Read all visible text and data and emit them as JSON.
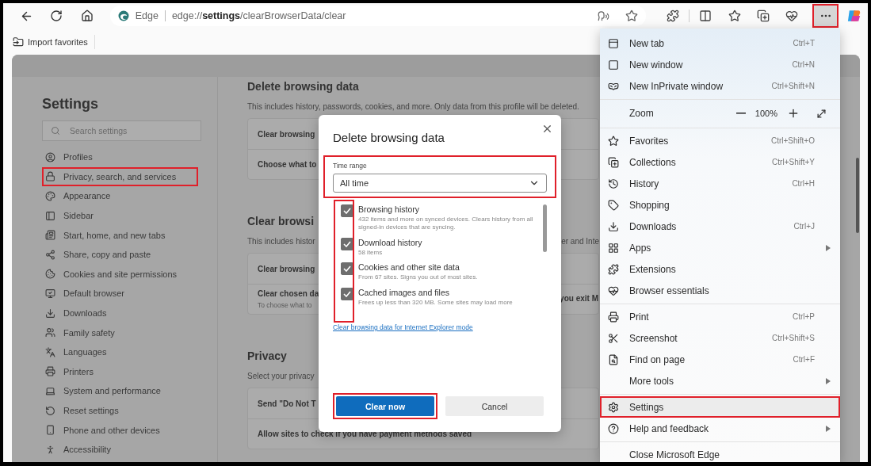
{
  "toolbar": {
    "site_label": "Edge",
    "url": "edge://**settings**/clearBrowserData/clear",
    "more_button": {
      "highlighted": true
    }
  },
  "favorites_bar": {
    "items": [
      {
        "label": "Import favorites"
      }
    ]
  },
  "sidebar": {
    "title": "Settings",
    "search": {
      "placeholder": "Search settings"
    },
    "items": [
      {
        "label": "Profiles",
        "highlighted": false
      },
      {
        "label": "Privacy, search, and services",
        "highlighted": true
      },
      {
        "label": "Appearance",
        "highlighted": false
      },
      {
        "label": "Sidebar",
        "highlighted": false
      },
      {
        "label": "Start, home, and new tabs",
        "highlighted": false
      },
      {
        "label": "Share, copy and paste",
        "highlighted": false
      },
      {
        "label": "Cookies and site permissions",
        "highlighted": false
      },
      {
        "label": "Default browser",
        "highlighted": false
      },
      {
        "label": "Downloads",
        "highlighted": false
      },
      {
        "label": "Family safety",
        "highlighted": false
      },
      {
        "label": "Languages",
        "highlighted": false
      },
      {
        "label": "Printers",
        "highlighted": false
      },
      {
        "label": "System and performance",
        "highlighted": false
      },
      {
        "label": "Reset settings",
        "highlighted": false
      },
      {
        "label": "Phone and other devices",
        "highlighted": false
      },
      {
        "label": "Accessibility",
        "highlighted": false
      }
    ]
  },
  "content": {
    "sections": [
      {
        "heading": "Delete browsing data",
        "description": "This includes history, passwords, cookies, and more. Only data from this profile will be deleted.",
        "rows": [
          {
            "title": "Clear browsing"
          },
          {
            "title": "Choose what to"
          }
        ]
      },
      {
        "heading": "Clear browsi",
        "description": "This includes histor",
        "description_tail": "er and Inte",
        "rows": [
          {
            "title": "Clear browsing"
          },
          {
            "title": "Clear chosen da",
            "subtitle": "To choose what to",
            "tail": "you exit M"
          }
        ]
      },
      {
        "heading": "Privacy",
        "description": "Select your privacy",
        "rows": [
          {
            "title": "Send \"Do Not T"
          },
          {
            "title": "Allow sites to check if you have payment methods saved"
          }
        ]
      }
    ]
  },
  "modal": {
    "title": "Delete browsing data",
    "time_range": {
      "label": "Time range",
      "value": "All time",
      "highlighted": true
    },
    "options": [
      {
        "title": "Browsing history",
        "detail": "432 items and more on synced devices. Clears history from all signed-in devices that are syncing.",
        "checked": true
      },
      {
        "title": "Download history",
        "detail": "58 items",
        "checked": true
      },
      {
        "title": "Cookies and other site data",
        "detail": "From 67 sites. Signs you out of most sites.",
        "checked": true
      },
      {
        "title": "Cached images and files",
        "detail": "Frees up less than 320 MB. Some sites may load more",
        "checked": true
      }
    ],
    "checkboxes_highlighted": true,
    "link": "Clear browsing data for Internet Explorer mode",
    "buttons": [
      {
        "label": "Clear now",
        "kind": "primary",
        "highlighted": true
      },
      {
        "label": "Cancel",
        "kind": "secondary",
        "highlighted": false
      }
    ]
  },
  "menu": {
    "sections": [
      {
        "items": [
          {
            "kind": "item",
            "label": "New tab",
            "shortcut": "Ctrl+T"
          },
          {
            "kind": "item",
            "label": "New window",
            "shortcut": "Ctrl+N"
          },
          {
            "kind": "item",
            "label": "New InPrivate window",
            "shortcut": "Ctrl+Shift+N"
          }
        ]
      },
      {
        "items": [
          {
            "kind": "zoom",
            "label": "Zoom",
            "value": "100%"
          }
        ]
      },
      {
        "items": [
          {
            "kind": "item",
            "label": "Favorites",
            "shortcut": "Ctrl+Shift+O"
          },
          {
            "kind": "item",
            "label": "Collections",
            "shortcut": "Ctrl+Shift+Y"
          },
          {
            "kind": "item",
            "label": "History",
            "shortcut": "Ctrl+H"
          },
          {
            "kind": "item",
            "label": "Shopping"
          },
          {
            "kind": "item",
            "label": "Downloads",
            "shortcut": "Ctrl+J"
          },
          {
            "kind": "item",
            "label": "Apps",
            "submenu": true
          },
          {
            "kind": "item",
            "label": "Extensions"
          },
          {
            "kind": "item",
            "label": "Browser essentials"
          }
        ]
      },
      {
        "items": [
          {
            "kind": "item",
            "label": "Print",
            "shortcut": "Ctrl+P"
          },
          {
            "kind": "item",
            "label": "Screenshot",
            "shortcut": "Ctrl+Shift+S"
          },
          {
            "kind": "item",
            "label": "Find on page",
            "shortcut": "Ctrl+F"
          },
          {
            "kind": "item",
            "label": "More tools",
            "submenu": true
          }
        ]
      },
      {
        "items": [
          {
            "kind": "item",
            "label": "Settings",
            "highlighted": true
          },
          {
            "kind": "item",
            "label": "Help and feedback",
            "submenu": true
          }
        ]
      },
      {
        "items": [
          {
            "kind": "item",
            "label": "Close Microsoft Edge"
          }
        ]
      }
    ]
  }
}
